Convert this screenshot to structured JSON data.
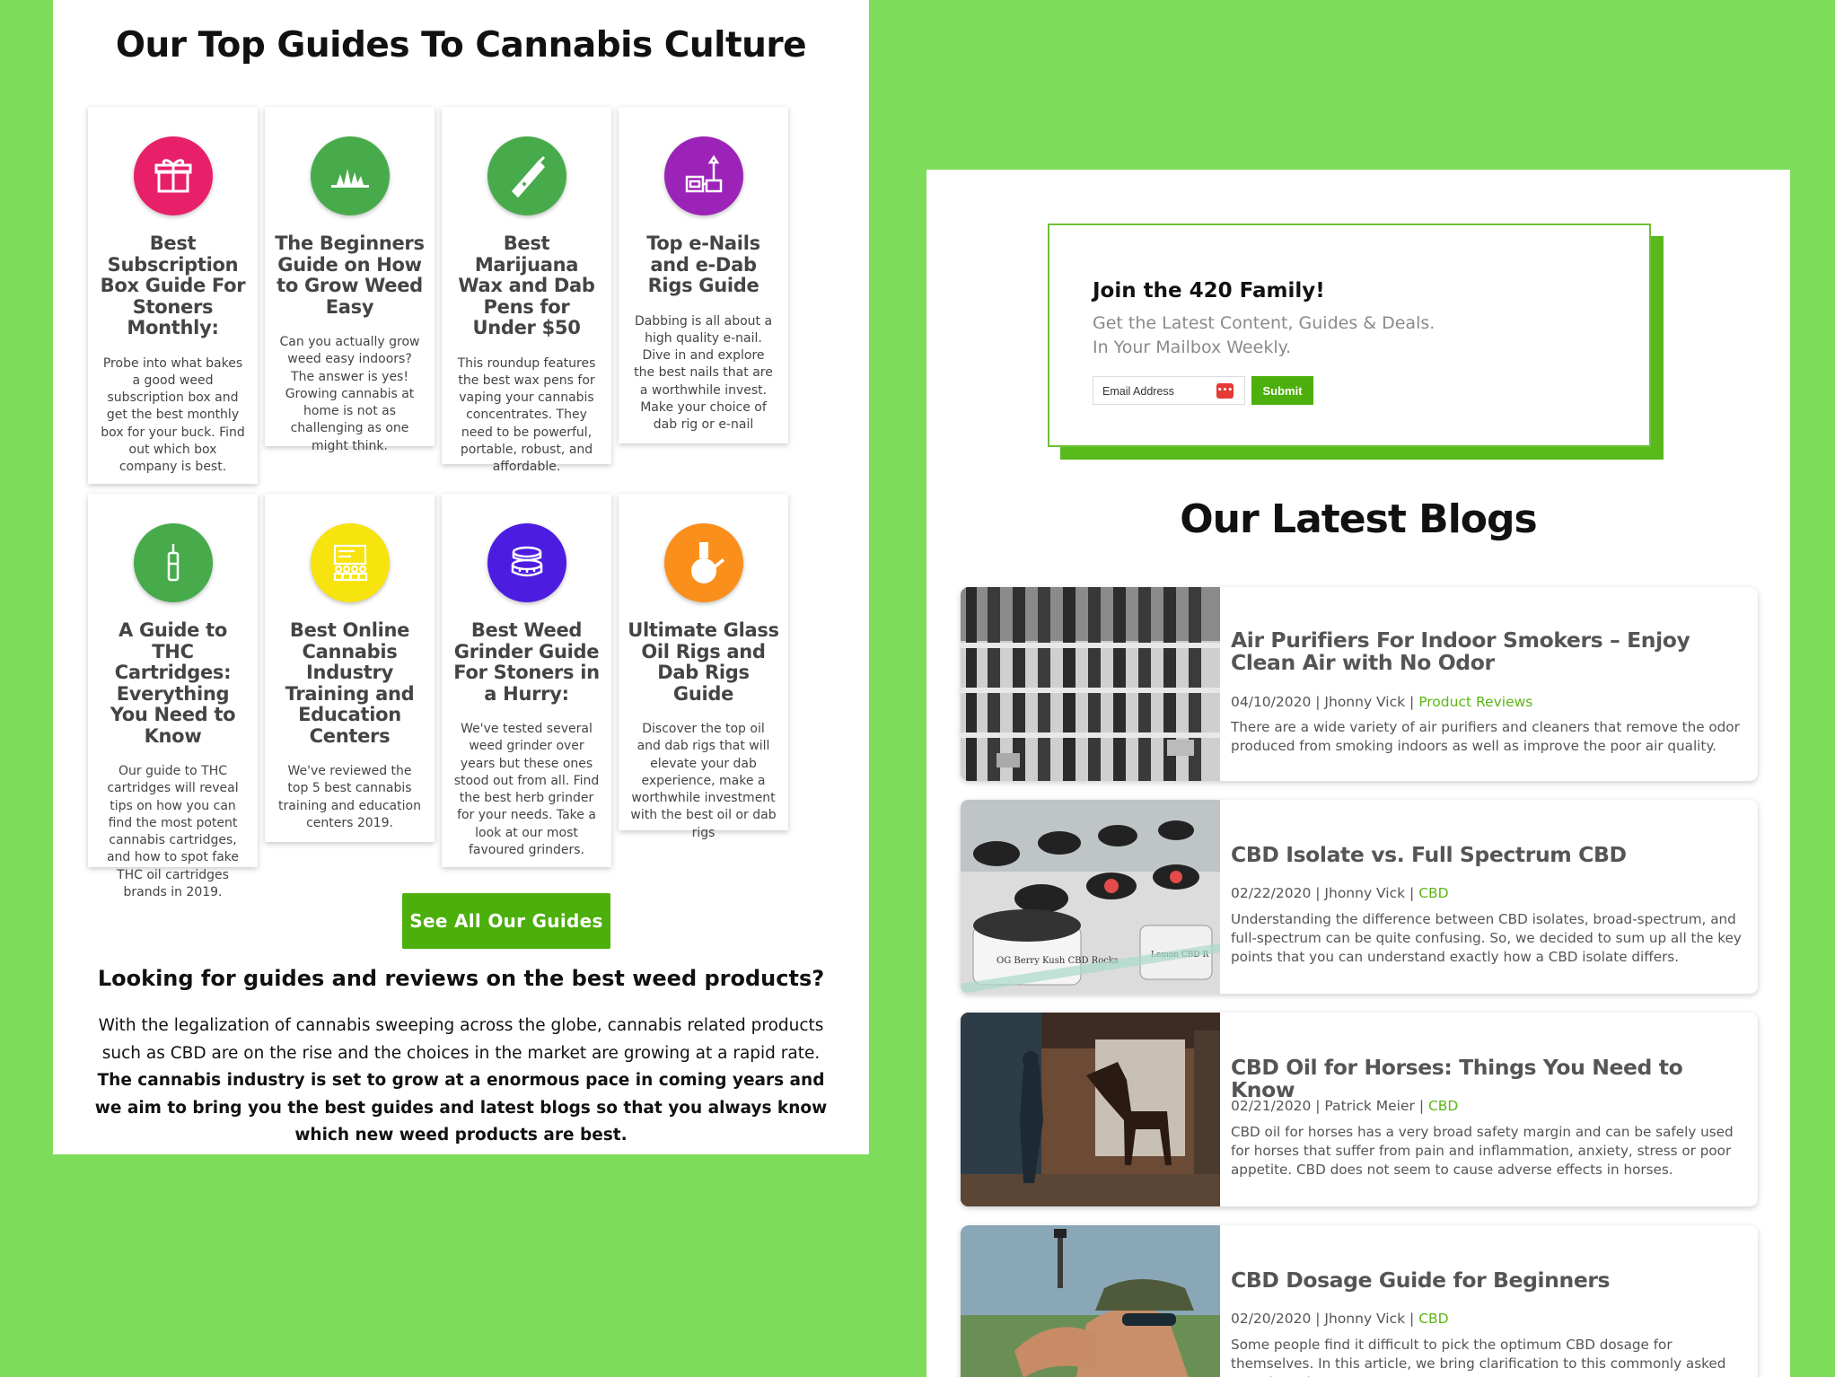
{
  "colors": {
    "background": "#7edc5b",
    "accent_green": "#4caf0c",
    "category_link": "#5cb516"
  },
  "left": {
    "title": "Our Top Guides To Cannabis Culture",
    "cards": [
      {
        "icon": "gift-icon",
        "color": "#e81f69",
        "title": "Best Subscription Box Guide For Stoners Monthly:",
        "desc": "Probe into what bakes a good weed subscription box and get the best monthly box for your buck. Find out which box company is best."
      },
      {
        "icon": "plant-sprout-icon",
        "color": "#47ab4b",
        "title": "The Beginners Guide on How to Grow Weed Easy",
        "desc": "Can you actually grow weed easy indoors? The answer is yes! Growing cannabis at home is not as challenging as one might think."
      },
      {
        "icon": "vape-pen-icon",
        "color": "#47ab4b",
        "title": "Best Marijuana Wax and Dab Pens for Under $50",
        "desc": "This roundup features the best wax pens for vaping your cannabis concentrates. They need to be powerful, portable, robust, and affordable."
      },
      {
        "icon": "enail-rig-icon",
        "color": "#9c23b8",
        "title": "Top e-Nails and e-Dab Rigs Guide",
        "desc": "Dabbing is all about a high quality e-nail. Dive in and explore the best nails that are a worthwhile invest. Make your choice of dab rig or e-nail"
      },
      {
        "icon": "cartridge-icon",
        "color": "#47ab4b",
        "title": "A Guide to THC Cartridges: Everything You Need to Know",
        "desc": "Our guide to THC cartridges will reveal tips on how you can find the most potent cannabis cartridges, and how to spot fake THC oil cartridges brands in 2019."
      },
      {
        "icon": "training-board-icon",
        "color": "#f7e30e",
        "title": "Best Online Cannabis Industry Training and Education Centers",
        "desc": "We've reviewed the top 5 best cannabis training and education centers 2019."
      },
      {
        "icon": "grinder-icon",
        "color": "#4c1de0",
        "title": "Best Weed Grinder Guide For Stoners in a Hurry:",
        "desc": "We've tested several weed grinder over years but these ones stood out from all. Find the best herb grinder for your needs. Take a look at our most favoured grinders."
      },
      {
        "icon": "bong-icon",
        "color": "#fb8f1b",
        "title": "Ultimate Glass Oil Rigs and Dab Rigs Guide",
        "desc": "Discover the top oil and dab rigs that will elevate your dab experience, make a worthwhile investment with the best oil or dab rigs"
      }
    ],
    "button_label": "See All Our Guides",
    "subheading": "Looking for guides and reviews on the best weed products?",
    "paragraph_normal": "With the legalization of cannabis sweeping across the globe, cannabis related products such as CBD are on the rise and the choices in the market are growing at a rapid rate.",
    "paragraph_bold": "The cannabis industry is set to grow at a enormous pace in coming years and we aim to bring you the best guides and latest blogs so that you always know which new weed products are best."
  },
  "newsletter": {
    "title": "Join the 420 Family!",
    "subtitle_line1": "Get the Latest Content, Guides & Deals.",
    "subtitle_line2": "In Your Mailbox Weekly.",
    "email_placeholder": "Email Address",
    "password_manager_icon": "•••",
    "submit_label": "Submit"
  },
  "blogs": {
    "title": "Our Latest Blogs",
    "posts": [
      {
        "title": "Air Purifiers For Indoor Smokers – Enjoy Clean Air with No Odor",
        "date": "04/10/2020",
        "author": "Jhonny Vick",
        "category": "Product Reviews",
        "excerpt": "There are a wide variety of air purifiers and cleaners that remove the odor produced from smoking indoors as well as improve the poor air quality.",
        "image": "building-facade-photo"
      },
      {
        "title": "CBD Isolate vs. Full Spectrum CBD",
        "date": "02/22/2020",
        "author": "Jhonny Vick",
        "category": "CBD",
        "excerpt": "Understanding the difference between CBD isolates, broad-spectrum, and full-spectrum can be quite confusing. So, we decided to sum up all the key points that you can understand exactly how a CBD isolate differs.",
        "image": "cbd-jars-photo",
        "jar_label_1": "OG Berry Kush CBD Rocks",
        "jar_label_2": "Lemon CBD R"
      },
      {
        "title": "CBD Oil for Horses: Things You Need to Know",
        "date": "02/21/2020",
        "author": "Patrick Meier",
        "category": "CBD",
        "excerpt": "CBD oil for horses has a very broad safety margin and can be safely used for horses that suffer from pain and inflammation, anxiety, stress or poor appetite. CBD does not seem to cause adverse effects in horses.",
        "image": "horse-stable-photo"
      },
      {
        "title": "CBD Dosage Guide for Beginners",
        "date": "02/20/2020",
        "author": "Jhonny Vick",
        "category": "CBD",
        "excerpt": "Some people find it difficult to pick the optimum CBD dosage for themselves. In this article, we bring clarification to this commonly asked question. There are",
        "image": "man-dropper-photo"
      }
    ]
  }
}
